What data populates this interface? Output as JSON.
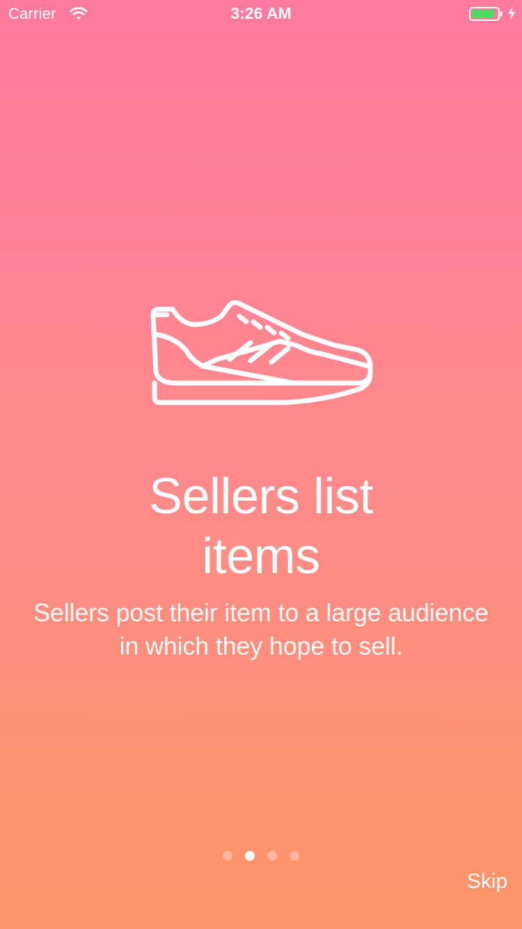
{
  "status_bar": {
    "carrier": "Carrier",
    "time": "3:26 AM",
    "icons": [
      "wifi-icon",
      "battery-icon",
      "charging-icon"
    ],
    "battery_color": "#4cd964"
  },
  "onboarding": {
    "illustration": "sneaker-icon",
    "title_lines": [
      "Sellers list",
      "items"
    ],
    "subtitle": "Sellers post their item to a large audience in which they hope to sell.",
    "pages_total": 4,
    "current_page": 2
  },
  "skip_label": "Skip",
  "colors": {
    "gradient_top": "#ff7a9e",
    "gradient_bottom": "#ff9566",
    "text": "#ffffff"
  }
}
